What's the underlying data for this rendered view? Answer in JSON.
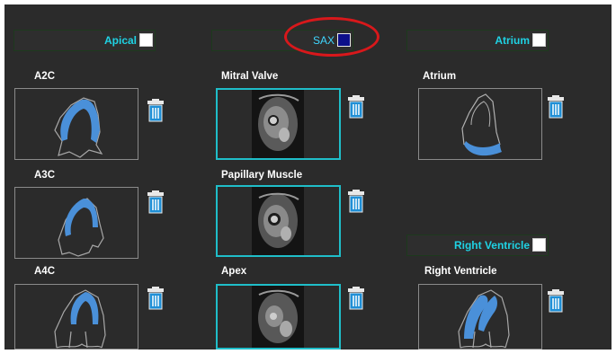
{
  "headers": {
    "apical": "Apical",
    "sax": "SAX",
    "atrium": "Atrium",
    "right_ventricle": "Right Ventricle"
  },
  "checkboxes": {
    "apical": false,
    "sax": true,
    "atrium": false,
    "right_ventricle": false
  },
  "labels": {
    "a2c": "A2C",
    "a3c": "A3C",
    "a4c": "A4C",
    "mitral_valve": "Mitral Valve",
    "papillary_muscle": "Papillary Muscle",
    "apex": "Apex",
    "atrium": "Atrium",
    "right_ventricle": "Right Ventricle"
  },
  "icons": {
    "delete": "trash-icon",
    "selected": "checkbox-checked",
    "unselected": "checkbox-empty"
  },
  "colors": {
    "header_text": "#1fd2e4",
    "active_border": "#1fbec9",
    "contour_blue": "#4a90d9",
    "highlight_ring": "#d8181b",
    "checked_fill": "#0d0f8a"
  }
}
